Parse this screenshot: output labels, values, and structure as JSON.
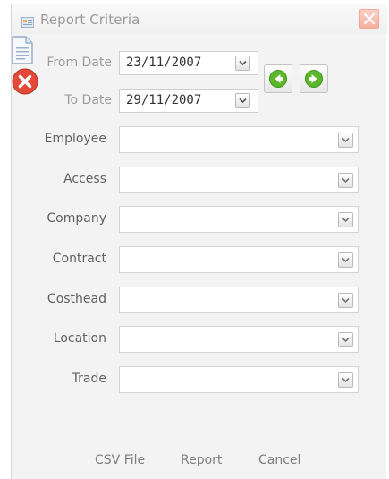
{
  "window": {
    "title": "Report Criteria"
  },
  "dates": {
    "from_label": "From Date",
    "from_value": "23/11/2007",
    "to_label": "To Date",
    "to_value": "29/11/2007"
  },
  "fields": [
    {
      "label": "Employee",
      "value": ""
    },
    {
      "label": "Access",
      "value": ""
    },
    {
      "label": "Company",
      "value": ""
    },
    {
      "label": "Contract",
      "value": ""
    },
    {
      "label": "Costhead",
      "value": ""
    },
    {
      "label": "Location",
      "value": ""
    },
    {
      "label": "Trade",
      "value": ""
    }
  ],
  "actions": {
    "csv_label": "CSV File",
    "report_label": "Report",
    "cancel_label": "Cancel"
  },
  "icons": {
    "app": "report-icon",
    "close": "close-icon",
    "prev": "arrow-left-icon",
    "next": "arrow-right-icon",
    "csv": "floppy-disk-icon",
    "report": "document-icon",
    "cancel": "cancel-x-icon"
  },
  "colors": {
    "nav_green": "#5cb82a",
    "cancel_red": "#e44a3a",
    "close_bg": "#f6b1a2"
  }
}
